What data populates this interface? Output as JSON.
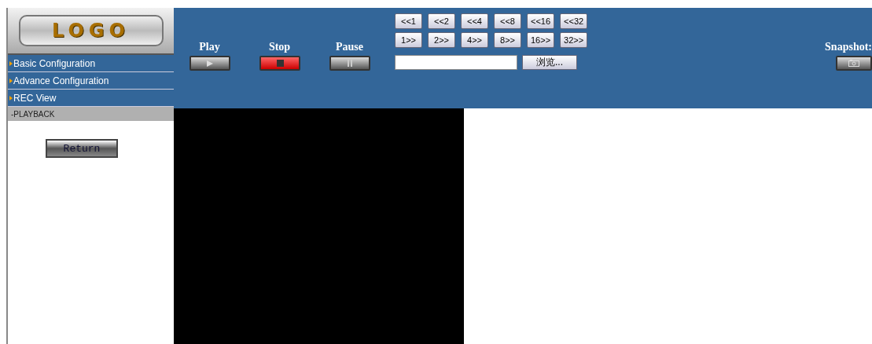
{
  "logo": {
    "text": "LOGO"
  },
  "menu": [
    {
      "label": "Basic Configuration"
    },
    {
      "label": "Advance Configuration"
    },
    {
      "label": "REC View"
    }
  ],
  "section": {
    "label": "-PLAYBACK"
  },
  "return_button": {
    "label": "Return"
  },
  "controls": [
    {
      "label": "Play",
      "kind": "play"
    },
    {
      "label": "Stop",
      "kind": "stop"
    },
    {
      "label": "Pause",
      "kind": "pause"
    }
  ],
  "rewind_buttons": [
    "<<1",
    "<<2",
    "<<4",
    "<<8",
    "<<16",
    "<<32"
  ],
  "forward_buttons": [
    "1>>",
    "2>>",
    "4>>",
    "8>>",
    "16>>",
    "32>>"
  ],
  "file_field": {
    "button": "浏览..."
  },
  "snapshot": {
    "label": "Snapshot:"
  }
}
